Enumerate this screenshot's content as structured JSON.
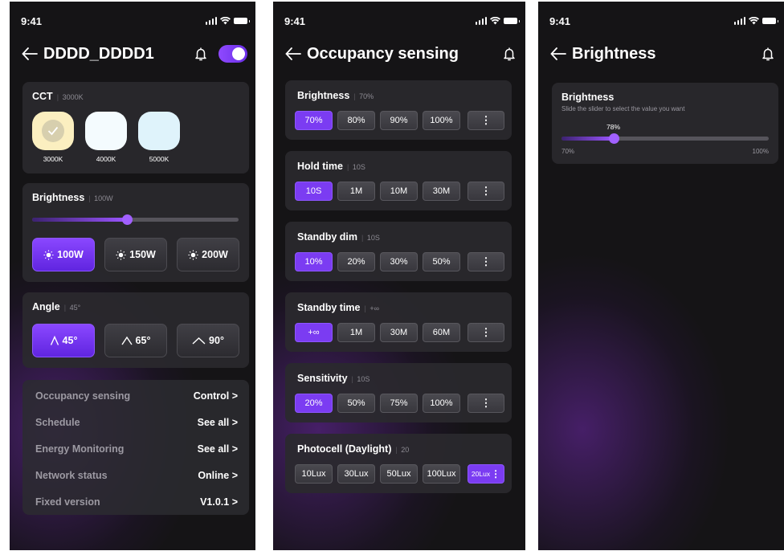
{
  "status_time": "9:41",
  "screen1": {
    "title": "DDDD_DDDD1",
    "cct": {
      "label": "CCT",
      "value": "3000K",
      "options": [
        {
          "label": "3000K",
          "color": "#fbefc0",
          "selected": true
        },
        {
          "label": "4000K",
          "color": "#f4fbfe",
          "selected": false
        },
        {
          "label": "5000K",
          "color": "#dff3fb",
          "selected": false
        }
      ]
    },
    "brightness": {
      "label": "Brightness",
      "value": "100W",
      "level": 0.46,
      "options": [
        "100W",
        "150W",
        "200W"
      ],
      "selected": 0
    },
    "angle": {
      "label": "Angle",
      "value": "45°",
      "options": [
        "45°",
        "65°",
        "90°"
      ],
      "selected": 0
    },
    "list": [
      {
        "label": "Occupancy sensing",
        "value": "Control >"
      },
      {
        "label": "Schedule",
        "value": "See all >"
      },
      {
        "label": "Energy Monitoring",
        "value": "See all >"
      },
      {
        "label": "Network status",
        "value": "Online >"
      },
      {
        "label": "Fixed version",
        "value": "V1.0.1 >"
      }
    ]
  },
  "screen2": {
    "title": "Occupancy sensing",
    "sections": [
      {
        "label": "Brightness",
        "value": "70%",
        "options": [
          "70%",
          "80%",
          "90%",
          "100%"
        ],
        "selected": 0
      },
      {
        "label": "Hold time",
        "value": "10S",
        "options": [
          "10S",
          "1M",
          "10M",
          "30M"
        ],
        "selected": 0
      },
      {
        "label": "Standby dim",
        "value": "10S",
        "options": [
          "10%",
          "20%",
          "30%",
          "50%"
        ],
        "selected": 0
      },
      {
        "label": "Standby time",
        "value": "+∞",
        "options": [
          "+∞",
          "1M",
          "30M",
          "60M"
        ],
        "selected": 0
      },
      {
        "label": "Sensitivity",
        "value": "10S",
        "options": [
          "20%",
          "50%",
          "75%",
          "100%"
        ],
        "selected": 0
      },
      {
        "label": "Photocell (Daylight)",
        "value": "20",
        "options": [
          "10Lux",
          "30Lux",
          "50Lux",
          "100Lux"
        ],
        "selected": -1,
        "custom": "20Lux"
      }
    ],
    "more_label": "⋮"
  },
  "screen3": {
    "title": "Brightness",
    "card_title": "Brightness",
    "hint": "Slide the slider to select the value you want",
    "value_label": "78%",
    "level": 0.25,
    "min_label": "70%",
    "max_label": "100%"
  },
  "colors": {
    "accent": "#7b3cf2",
    "background": "#151416",
    "card": "#2a292e"
  }
}
